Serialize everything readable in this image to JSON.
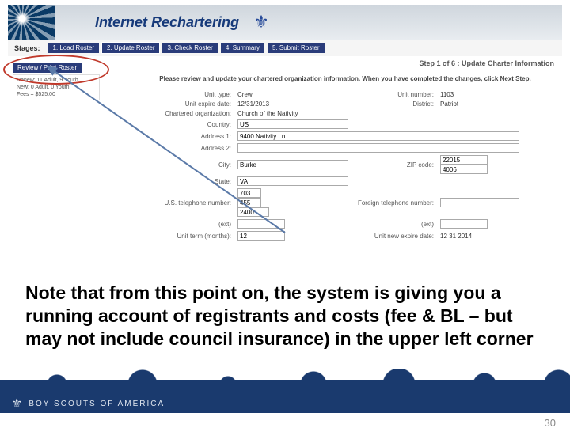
{
  "banner": {
    "title": "Internet Rechartering"
  },
  "stages": {
    "label": "Stages:",
    "items": [
      "1. Load Roster",
      "2. Update Roster",
      "3. Check Roster",
      "4. Summary",
      "5. Submit Roster"
    ],
    "active_index": 1
  },
  "left": {
    "review_button": "Review / Print Roster",
    "tally_line1": "Renew: 11 Adult, 9 Youth",
    "tally_line2": "New: 0 Adult, 0 Youth",
    "tally_line3": "Fees = $525.00"
  },
  "step_header": "Step 1 of 6 : Update Charter Information",
  "instructions": "Please review and update your chartered organization information. When you have completed the changes, click Next Step.",
  "form": {
    "unit_type_label": "Unit type:",
    "unit_type": "Crew",
    "unit_number_label": "Unit number:",
    "unit_number": "1103",
    "expire_label": "Unit expire date:",
    "expire": "12/31/2013",
    "district_label": "District:",
    "district": "Patriot",
    "org_label": "Chartered organization:",
    "org": "Church of the Nativity",
    "country_label": "Country:",
    "country": "US",
    "addr1_label": "Address 1:",
    "addr1": "9400 Nativity Ln",
    "addr2_label": "Address 2:",
    "addr2": "",
    "city_label": "City:",
    "city": "Burke",
    "zip_label": "ZIP code:",
    "zip1": "22015",
    "zip2": "4006",
    "state_label": "State:",
    "state": "VA",
    "phone_label": "U.S. telephone number:",
    "phone1": "703",
    "phone2": "455",
    "phone3": "2400",
    "foreign_label": "Foreign telephone number:",
    "foreign": "",
    "ext1_label": "(ext)",
    "ext2_label": "(ext)",
    "term_label": "Unit term (months):",
    "term": "12",
    "new_expire_label": "Unit new expire date:",
    "new_expire": "12 31 2014"
  },
  "caption": "Note that from this point on, the system is giving you a running account of registrants and costs (fee & BL – but may not include council insurance) in the upper left corner",
  "footer": {
    "org": "BOY SCOUTS OF AMERICA"
  },
  "page_number": "30"
}
